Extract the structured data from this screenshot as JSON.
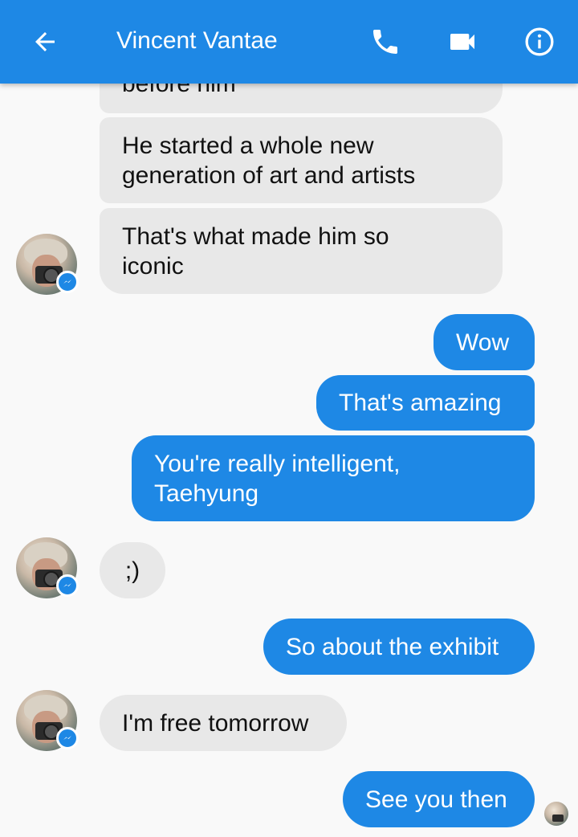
{
  "header": {
    "contact_name": "Vincent Vantae",
    "back_icon": "arrow-back-icon",
    "call_icon": "phone-icon",
    "video_icon": "video-camera-icon",
    "info_icon": "info-icon",
    "bar_color": "#1e88e5"
  },
  "messages": [
    {
      "from": "them",
      "lines": [
        "before him"
      ]
    },
    {
      "from": "them",
      "lines": [
        "He started a whole new",
        "generation of art and artists"
      ]
    },
    {
      "from": "them",
      "lines": [
        "That's what made him so",
        "iconic"
      ]
    },
    {
      "from": "me",
      "lines": [
        "Wow"
      ]
    },
    {
      "from": "me",
      "lines": [
        "That's amazing"
      ]
    },
    {
      "from": "me",
      "lines": [
        "You're really intelligent,",
        "Taehyung"
      ]
    },
    {
      "from": "them",
      "lines": [
        ";)"
      ]
    },
    {
      "from": "me",
      "lines": [
        "So about the exhibit"
      ]
    },
    {
      "from": "them",
      "lines": [
        "I'm free tomorrow"
      ]
    },
    {
      "from": "me",
      "lines": [
        "See you then"
      ]
    }
  ],
  "colors": {
    "outgoing_bubble": "#1e88e5",
    "incoming_bubble": "#e8e8e8",
    "background": "#f9f9f9"
  },
  "icons": {
    "avatar_badge": "messenger-badge-icon",
    "seen_indicator": "read-receipt-avatar"
  }
}
